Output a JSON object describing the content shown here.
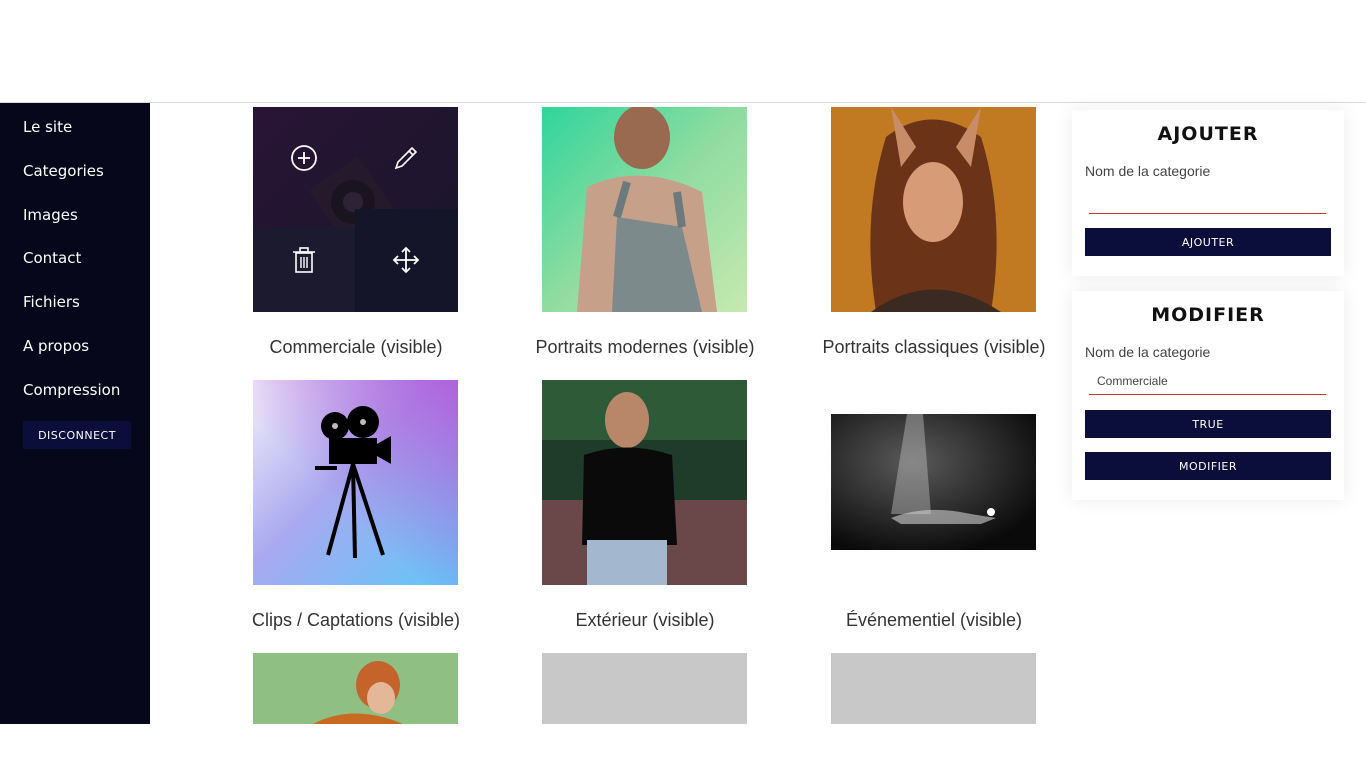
{
  "sidebar": {
    "items": [
      {
        "label": "Le site"
      },
      {
        "label": "Categories"
      },
      {
        "label": "Images"
      },
      {
        "label": "Contact"
      },
      {
        "label": "Fichiers"
      },
      {
        "label": "A propos"
      },
      {
        "label": "Compression"
      }
    ],
    "disconnect_label": "DISCONNECT"
  },
  "categories": [
    {
      "caption": "Commerciale (visible)",
      "image": "film-camera-dark-with-actions"
    },
    {
      "caption": "Portraits modernes (visible)",
      "image": "man-overalls-green-background"
    },
    {
      "caption": "Portraits classiques (visible)",
      "image": "woman-hands-in-hair-orange"
    },
    {
      "caption": "Clips / Captations (visible)",
      "image": "film-camera-silhouette-gradient"
    },
    {
      "caption": "Extérieur (visible)",
      "image": "young-man-black-tshirt-outdoors"
    },
    {
      "caption": "Événementiel (visible)",
      "image": "stage-spotlight-dancer"
    }
  ],
  "tile_actions": {
    "add_icon": "plus-circle-icon",
    "edit_icon": "pencil-icon",
    "delete_icon": "trash-icon",
    "move_icon": "move-arrows-icon"
  },
  "add_panel": {
    "title": "AJOUTER",
    "field_label": "Nom de la categorie",
    "input_value": "",
    "button_label": "AJOUTER"
  },
  "edit_panel": {
    "title": "MODIFIER",
    "field_label": "Nom de la categorie",
    "input_value": "Commerciale",
    "toggle_label": "TRUE",
    "button_label": "MODIFIER"
  },
  "colors": {
    "sidebar_bg": "#06071a",
    "button_bg": "#0b0d3a",
    "input_underline": "#c0392b"
  }
}
